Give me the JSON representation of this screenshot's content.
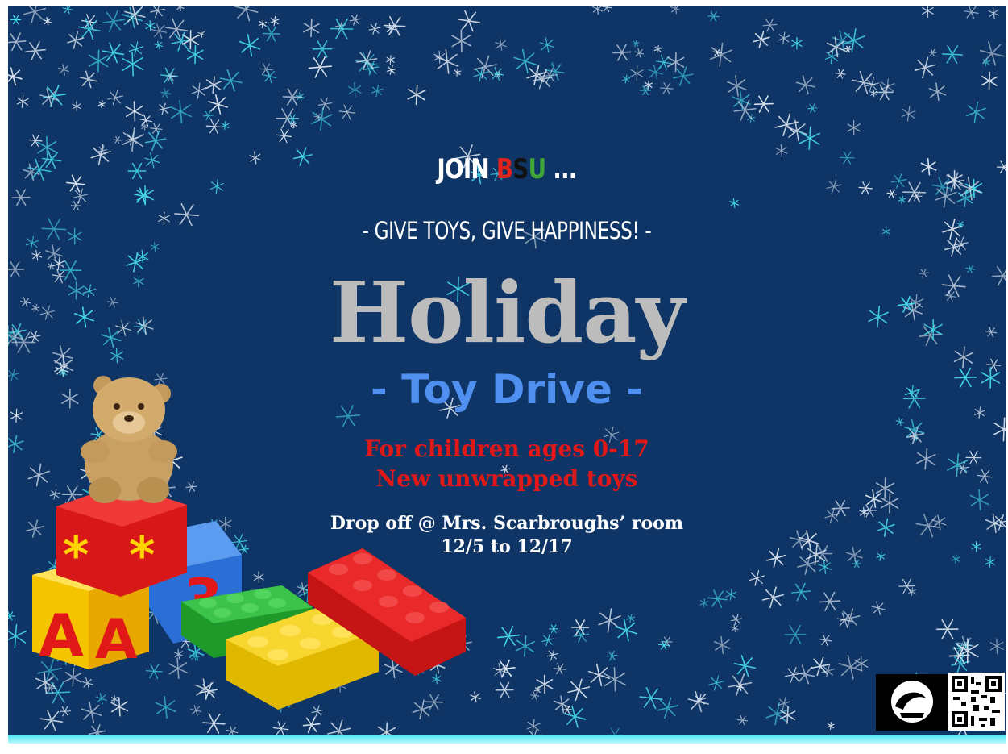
{
  "flyer": {
    "join_prefix": "JOIN",
    "join_b": "B",
    "join_s": "S",
    "join_u": "U",
    "join_suffix": "...",
    "tagline": "- GIVE TOYS, GIVE HAPPINESS! -",
    "title": "Holiday",
    "subtitle": "- Toy Drive -",
    "ages": "For children ages 0-17",
    "toys": "New unwrapped toys",
    "drop_off": "Drop off @ Mrs. Scarbroughs’ room",
    "dates": "12/5 to 12/17"
  },
  "colors": {
    "background": "#0e3566",
    "title": "#bcbcbc",
    "subtitle": "#4e8ff0",
    "details": "#e01818",
    "bsu_b": "#e0241b",
    "bsu_s": "#111111",
    "bsu_u": "#3fa535"
  },
  "decor": {
    "snowflakes": "snowflake-icon",
    "teddy": "teddy-bear-icon",
    "blocks": "alphabet-block-icon",
    "bricks": "toy-brick-icon",
    "logo": "school-logo-icon",
    "qr": "qr-code-icon"
  }
}
